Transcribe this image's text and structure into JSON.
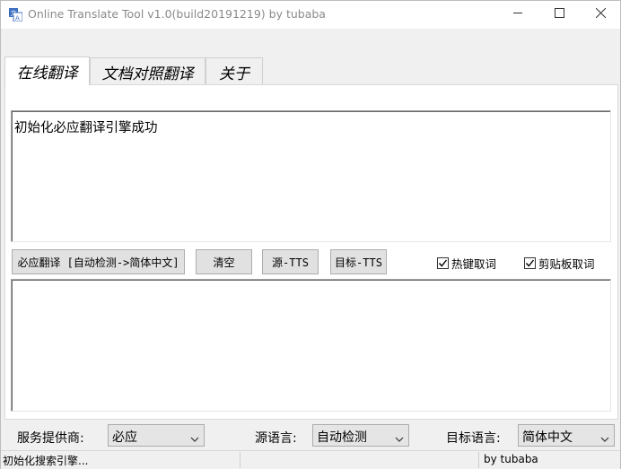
{
  "window": {
    "title": "Online Translate Tool v1.0(build20191219) by tubaba",
    "icon": "translate-app-icon"
  },
  "tabs": [
    {
      "label": "在线翻译",
      "active": true
    },
    {
      "label": "文档对照翻译",
      "active": false
    },
    {
      "label": "关于",
      "active": false
    }
  ],
  "source": {
    "text": "初始化必应翻译引擎成功"
  },
  "target": {
    "text": ""
  },
  "toolbar": {
    "translate_label": "必应翻译 [自动检测->简体中文]",
    "clear_label": "清空",
    "source_tts_label": "源-TTS",
    "target_tts_label": "目标-TTS"
  },
  "options": {
    "hotkey_label": "热键取词",
    "hotkey_checked": true,
    "clipboard_label": "剪贴板取词",
    "clipboard_checked": true
  },
  "settings": {
    "provider_label": "服务提供商:",
    "provider_value": "必应",
    "source_lang_label": "源语言:",
    "source_lang_value": "自动检测",
    "target_lang_label": "目标语言:",
    "target_lang_value": "简体中文"
  },
  "status": {
    "message": "初始化搜索引擎...",
    "credit": "by tubaba"
  }
}
